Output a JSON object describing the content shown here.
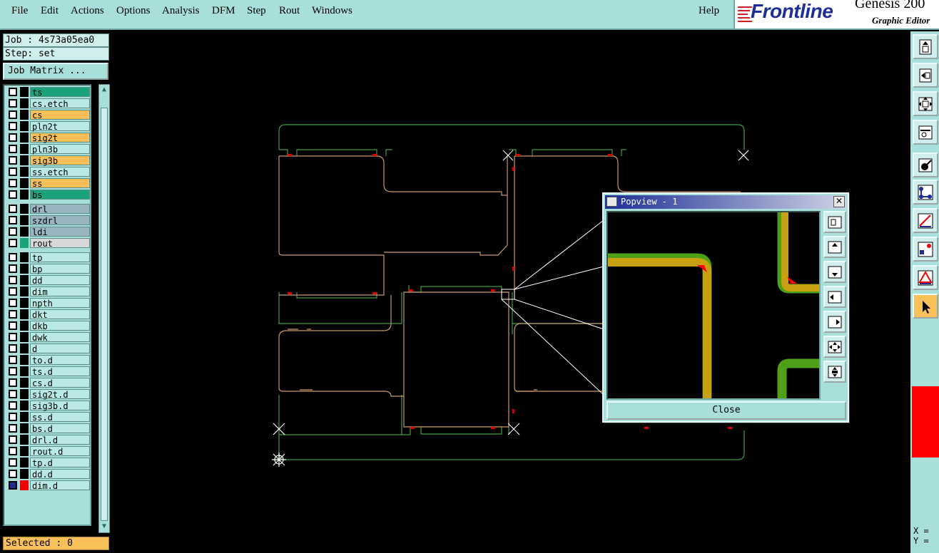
{
  "menubar": {
    "items": [
      "File",
      "Edit",
      "Actions",
      "Options",
      "Analysis",
      "DFM",
      "Step",
      "Rout",
      "Windows"
    ],
    "help": "Help"
  },
  "logo": {
    "brand": "Frontline",
    "product": "Genesis 200",
    "subtitle": "Graphic Editor"
  },
  "job": {
    "job_label": "Job : 4s73a05ea0",
    "step_label": "Step: set",
    "matrix_button": "Job Matrix ..."
  },
  "layers": [
    {
      "name": "ts",
      "color": "#1aa37a"
    },
    {
      "name": "cs.etch",
      "color": "#b9e9e6"
    },
    {
      "name": "cs",
      "color": "#f9c05a"
    },
    {
      "name": "pln2t",
      "color": "#b9e9e6"
    },
    {
      "name": "sig2t",
      "color": "#f9c05a"
    },
    {
      "name": "pln3b",
      "color": "#b9e9e6"
    },
    {
      "name": "sig3b",
      "color": "#f9c05a"
    },
    {
      "name": "ss.etch",
      "color": "#b9e9e6"
    },
    {
      "name": "ss",
      "color": "#f9c05a"
    },
    {
      "name": "bs",
      "color": "#1aa37a"
    },
    {
      "name": "drl",
      "color": "#9ab4c0"
    },
    {
      "name": "szdrl",
      "color": "#9ab4c0"
    },
    {
      "name": "ldi",
      "color": "#9ab4c0"
    },
    {
      "name": "rout",
      "color": "#d8d8d8"
    },
    {
      "name": "tp",
      "color": "#b9e9e6"
    },
    {
      "name": "bp",
      "color": "#b9e9e6"
    },
    {
      "name": "dd",
      "color": "#b9e9e6"
    },
    {
      "name": "dim",
      "color": "#b9e9e6"
    },
    {
      "name": "npth",
      "color": "#b9e9e6"
    },
    {
      "name": "dkt",
      "color": "#b9e9e6"
    },
    {
      "name": "dkb",
      "color": "#b9e9e6"
    },
    {
      "name": "dwk",
      "color": "#b9e9e6"
    },
    {
      "name": "d",
      "color": "#b9e9e6"
    },
    {
      "name": "to.d",
      "color": "#b9e9e6"
    },
    {
      "name": "ts.d",
      "color": "#b9e9e6"
    },
    {
      "name": "cs.d",
      "color": "#b9e9e6"
    },
    {
      "name": "sig2t.d",
      "color": "#b9e9e6"
    },
    {
      "name": "sig3b.d",
      "color": "#b9e9e6"
    },
    {
      "name": "ss.d",
      "color": "#b9e9e6"
    },
    {
      "name": "bs.d",
      "color": "#b9e9e6"
    },
    {
      "name": "drl.d",
      "color": "#b9e9e6"
    },
    {
      "name": "rout.d",
      "color": "#b9e9e6"
    },
    {
      "name": "tp.d",
      "color": "#b9e9e6"
    },
    {
      "name": "dd.d",
      "color": "#b9e9e6"
    },
    {
      "name": "dim.d",
      "color": "#b9e9e6"
    }
  ],
  "status": {
    "selected": "Selected : 0"
  },
  "popview": {
    "title": "Popview - 1",
    "close_label": "Close"
  },
  "coords": {
    "x_label": "X =",
    "y_label": "Y ="
  },
  "colors": {
    "panel": "#a9dfdb",
    "trace_yellow": "#c8a010",
    "trace_green": "#4ea018",
    "outline_green": "#3f9b3f",
    "outline_tan": "#c89a6a",
    "highlight": "#f9c05a"
  },
  "icons": {
    "toolbar": [
      "zoom-home-icon",
      "zoom-in-icon",
      "fit-icon",
      "measure-icon",
      "snap-icon",
      "net-icon",
      "draw-line-icon",
      "component-icon",
      "drc-icon",
      "pointer-icon"
    ],
    "popview_tools": [
      "zoom-in-icon",
      "zoom-up-icon",
      "zoom-down-icon",
      "zoom-left-icon",
      "zoom-right-icon",
      "fit-all-icon",
      "center-icon"
    ]
  }
}
